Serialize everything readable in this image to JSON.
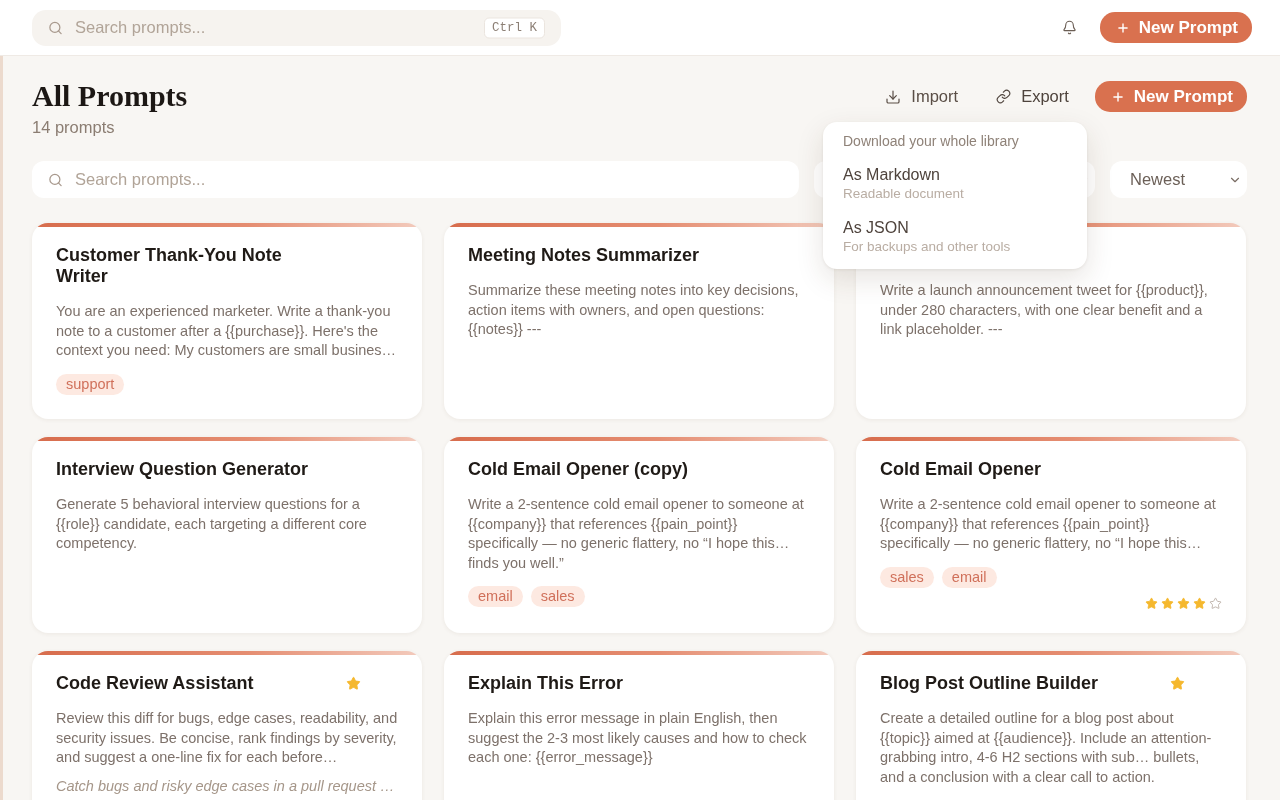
{
  "top_bar": {
    "search": {
      "placeholder": "Search prompts..."
    },
    "shortcut": "Ctrl K",
    "new_button": "New Prompt"
  },
  "header": {
    "title": "All Prompts",
    "count": "14 prompts",
    "actions": [
      {
        "kind": "import",
        "label": "Import",
        "expanded": false
      },
      {
        "kind": "export",
        "label": "Export",
        "expanded": true,
        "menu": {
          "heading": "Download your whole library",
          "items": [
            {
              "label": "As Markdown",
              "description": "Readable document"
            },
            {
              "label": "As JSON",
              "description": "For backups and other tools"
            }
          ]
        }
      }
    ],
    "new_button": "New Prompt"
  },
  "filters": {
    "search": {
      "placeholder": "Search prompts..."
    },
    "sort": {
      "value": "Newest"
    }
  },
  "prompts": [
    {
      "title": "Customer Thank-You Note Writer",
      "starred": false,
      "description": "You are an experienced marketer. Write a thank-you note to a customer after a {{purchase}}. Here's the context you need: My customers are small busines…",
      "tags": [
        "support"
      ]
    },
    {
      "title": "Meeting Notes Summarizer",
      "starred": false,
      "description": "Summarize these meeting notes into key decisions, action items with owners, and open questions: {{notes}} ---"
    },
    {
      "starred": false,
      "description": "Write a launch announcement tweet for {{product}}, under 280 characters, with one clear benefit and a link placeholder. ---"
    },
    {
      "title": "Interview Question Generator",
      "starred": false,
      "description": "Generate 5 behavioral interview questions for a {{role}} candidate, each targeting a different core competency."
    },
    {
      "title": "Cold Email Opener (copy)",
      "starred": false,
      "description": "Write a 2-sentence cold email opener to someone at {{company}} that references {{pain_point}} specifically — no generic flattery, no “I hope this… finds you well.”",
      "tags": [
        "email",
        "sales"
      ]
    },
    {
      "title": "Cold Email Opener",
      "starred": false,
      "description": "Write a 2-sentence cold email opener to someone at {{company}} that references {{pain_point}} specifically — no generic flattery, no “I hope this…",
      "tags": [
        "sales",
        "email"
      ],
      "stars": 4
    },
    {
      "title": "Code Review Assistant",
      "starred": true,
      "description": "Review this diff for bugs, edge cases, readability, and security issues. Be concise, rank findings by severity, and suggest a one-line fix for each before…",
      "note": "Catch bugs and risky edge cases in a pull request …"
    },
    {
      "title": "Explain This Error",
      "starred": false,
      "description": "Explain this error message in plain English, then suggest the 2-3 most likely causes and how to check each one: {{error_message}}"
    },
    {
      "title": "Blog Post Outline Builder",
      "starred": true,
      "description": "Create a detailed outline for a blog post about {{topic}} aimed at {{audience}}. Include an attention-grabbing intro, 4-6 H2 sections with sub… bullets, and a conclusion with a clear call to action."
    }
  ]
}
